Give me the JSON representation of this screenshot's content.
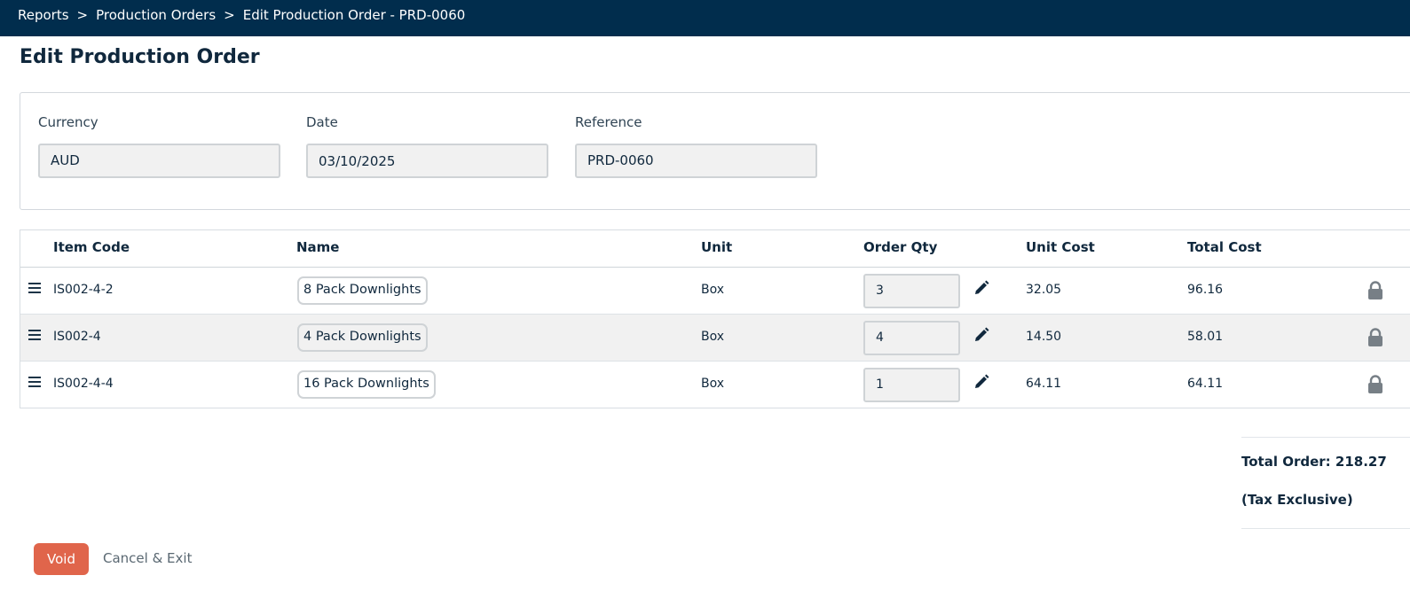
{
  "breadcrumb": {
    "items": [
      "Reports",
      "Production Orders",
      "Edit Production Order - PRD-0060"
    ],
    "separator": ">"
  },
  "page_title": "Edit Production Order",
  "form": {
    "currency": {
      "label": "Currency",
      "value": "AUD"
    },
    "date": {
      "label": "Date",
      "value": "03/10/2025"
    },
    "reference": {
      "label": "Reference",
      "value": "PRD-0060"
    }
  },
  "table": {
    "columns": {
      "item_code": "Item Code",
      "name": "Name",
      "unit": "Unit",
      "order_qty": "Order Qty",
      "unit_cost": "Unit Cost",
      "total_cost": "Total Cost"
    },
    "rows": [
      {
        "item_code": "IS002-4-2",
        "name": "8 Pack Downlights",
        "unit": "Box",
        "qty": "3",
        "unit_cost": "32.05",
        "total_cost": "96.16"
      },
      {
        "item_code": "IS002-4",
        "name": "4 Pack Downlights",
        "unit": "Box",
        "qty": "4",
        "unit_cost": "14.50",
        "total_cost": "58.01"
      },
      {
        "item_code": "IS002-4-4",
        "name": "16 Pack Downlights",
        "unit": "Box",
        "qty": "1",
        "unit_cost": "64.11",
        "total_cost": "64.11"
      }
    ],
    "icons": {
      "drag": "drag-handle-icon",
      "edit": "pencil-icon",
      "locked": "lock-icon"
    }
  },
  "summary": {
    "total_label": "Total Order:",
    "total_value": "218.27",
    "tax_note": "(Tax Exclusive)"
  },
  "actions": {
    "void_label": "Void",
    "cancel_label": "Cancel & Exit"
  },
  "colors": {
    "topbar": "#012d4d",
    "void_button": "#e0654b",
    "text_primary": "#10283d"
  }
}
